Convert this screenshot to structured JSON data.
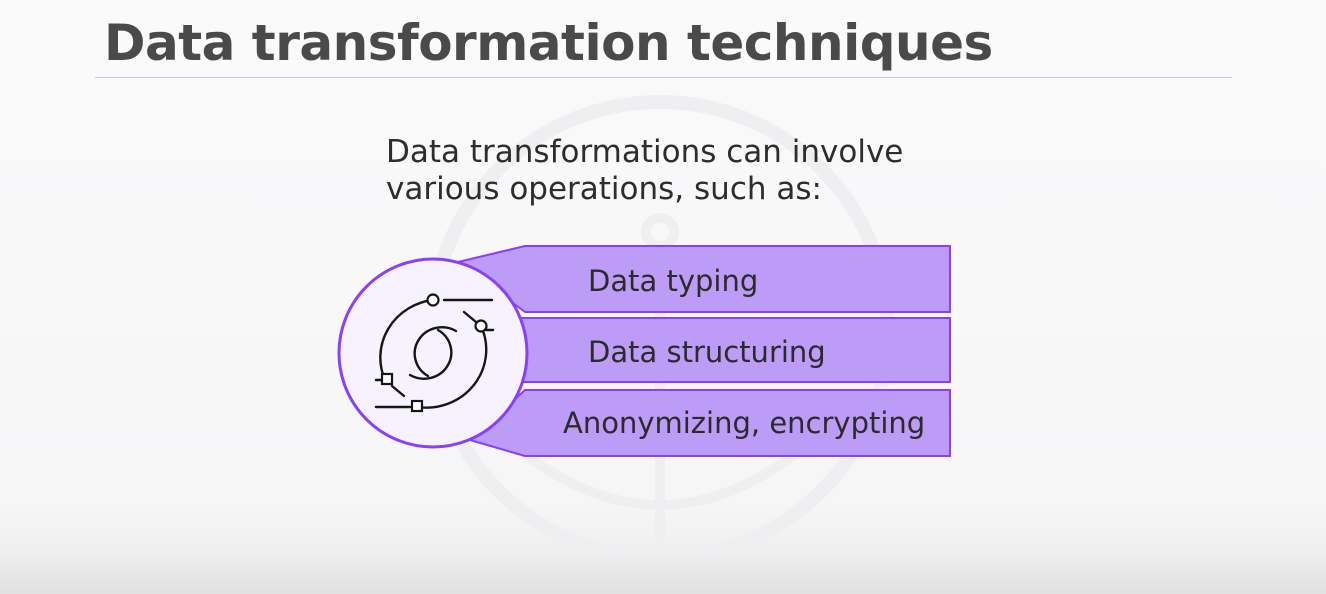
{
  "slide": {
    "title": "Data transformation techniques",
    "intro_line_1": "Data transformations can involve",
    "intro_line_2": "various operations, such as:",
    "operations": [
      {
        "label": "Data typing"
      },
      {
        "label": "Data structuring"
      },
      {
        "label": "Anonymizing, encrypting"
      }
    ],
    "hub_icon": "data-transformation-icon"
  },
  "colors": {
    "bar_fill": "#bc9cf7",
    "bar_stroke": "#8a3ffc",
    "hub_fill": "#f6f2ff",
    "title_rule": "#c9c6e6"
  }
}
